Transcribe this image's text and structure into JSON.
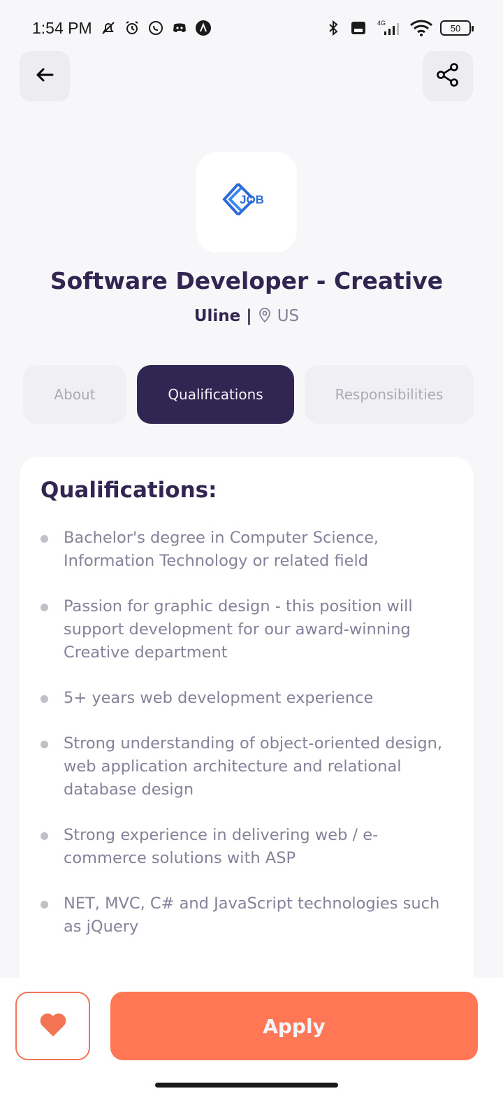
{
  "status_bar": {
    "time": "1:54 PM",
    "network": "4G",
    "battery": "50",
    "icons": [
      "mute-icon",
      "alarm-icon",
      "whatsapp-icon",
      "discord-icon",
      "app-icon",
      "bluetooth-icon",
      "volte-icon",
      "signal-icon",
      "wifi-icon"
    ]
  },
  "header": {
    "back_icon": "arrow-left-icon",
    "share_icon": "share-icon"
  },
  "job": {
    "logo_text": "JOB",
    "title": "Software Developer - Creative",
    "company": "Uline",
    "separator": "|",
    "location": "US"
  },
  "tabs": [
    {
      "label": "About",
      "active": false
    },
    {
      "label": "Qualifications",
      "active": true
    },
    {
      "label": "Responsibilities",
      "active": false
    }
  ],
  "qualifications": {
    "heading": "Qualifications:",
    "items": [
      "Bachelor's degree in Computer Science, Information Technology or related field",
      "Passion for graphic design - this position will support development for our award-winning Creative department",
      "5+ years web development experience",
      "Strong understanding of object-oriented design, web application architecture and relational database design",
      "Strong experience in delivering web / e-commerce solutions with ASP",
      "NET, MVC, C# and JavaScript technologies such as jQuery"
    ]
  },
  "footer": {
    "favorite_icon": "heart-icon",
    "apply_label": "Apply"
  },
  "colors": {
    "primary": "#312651",
    "accent": "#FF7754",
    "gray": "#83829A",
    "background": "#F7F7FA"
  }
}
